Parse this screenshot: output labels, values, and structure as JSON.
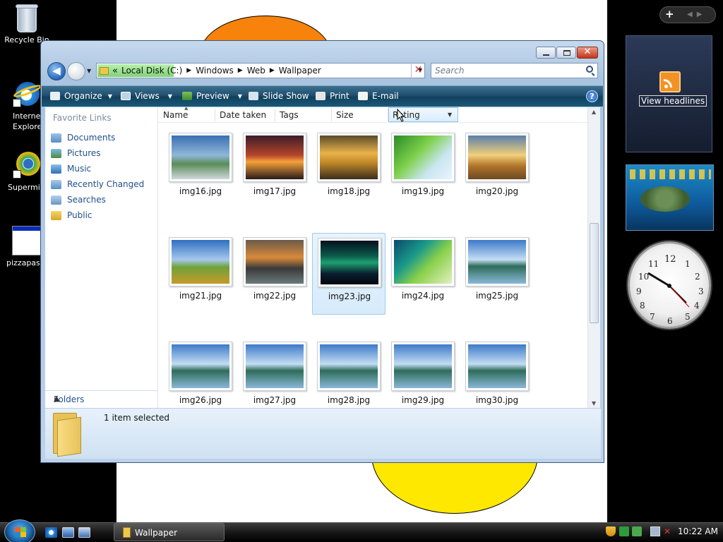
{
  "desktop": {
    "icons": [
      {
        "label": "Recycle Bin",
        "icon": "recycle-bin-icon"
      },
      {
        "label": "Internet Explorer",
        "icon": "internet-explorer-icon"
      },
      {
        "label": "Supermium",
        "icon": "supermium-icon"
      },
      {
        "label": "pizzapasta",
        "icon": "application-window-icon"
      }
    ]
  },
  "sidebar": {
    "add_gadget": "+",
    "feed_label": "View headlines"
  },
  "window": {
    "breadcrumb": {
      "overflow": "«",
      "items": [
        "Local Disk (C:)",
        "Windows",
        "Web",
        "Wallpaper"
      ]
    },
    "search_placeholder": "Search",
    "toolbar": {
      "organize": "Organize",
      "views": "Views",
      "preview": "Preview",
      "slideshow": "Slide Show",
      "print": "Print",
      "email": "E-mail",
      "help": "?"
    },
    "nav": {
      "favorites_title": "Favorite Links",
      "links": [
        "Documents",
        "Pictures",
        "Music",
        "Recently Changed",
        "Searches",
        "Public"
      ],
      "folders_label": "Folders"
    },
    "columns": [
      "Name",
      "Date taken",
      "Tags",
      "Size",
      "Rating"
    ],
    "files": [
      "img16.jpg",
      "img17.jpg",
      "img18.jpg",
      "img19.jpg",
      "img20.jpg",
      "img21.jpg",
      "img22.jpg",
      "img23.jpg",
      "img24.jpg",
      "img25.jpg",
      "img26.jpg",
      "img27.jpg",
      "img28.jpg",
      "img29.jpg",
      "img30.jpg"
    ],
    "selected_file": "img23.jpg",
    "status": "1 item selected"
  },
  "taskbar": {
    "task_label": "Wallpaper",
    "time": "10:22 AM"
  },
  "colors": {
    "toolbar_dark": "#10405c",
    "link_blue": "#1f4f8c",
    "selection": "#d6ebfb"
  }
}
